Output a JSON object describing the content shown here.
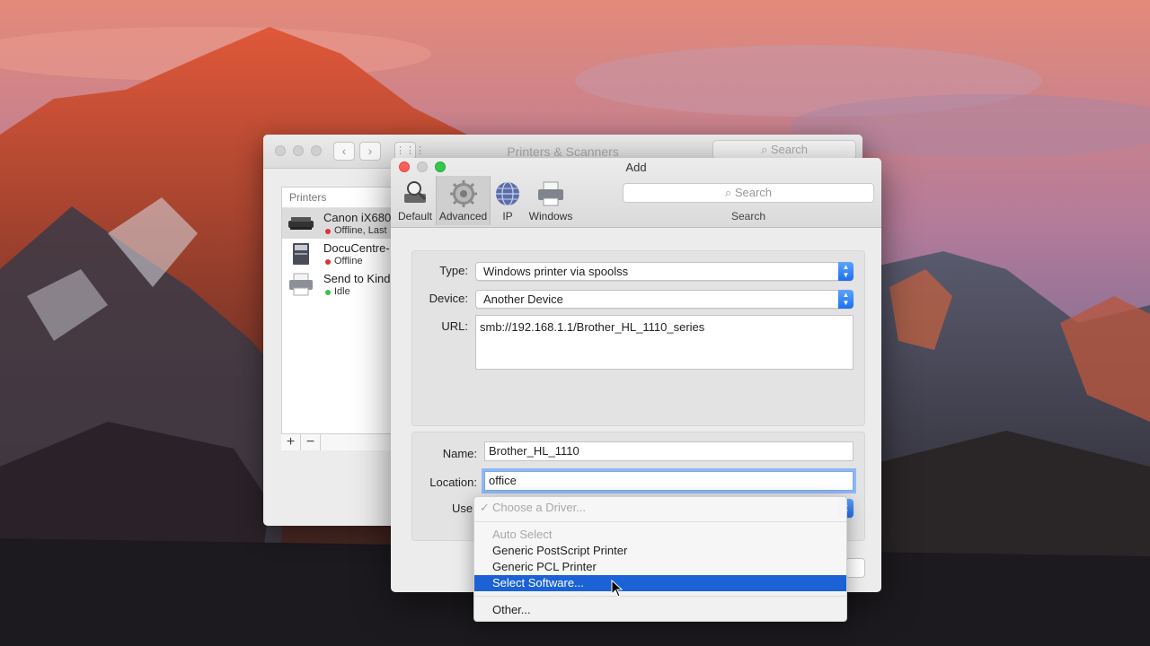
{
  "printers_window": {
    "title": "Printers & Scanners",
    "search_placeholder": "Search",
    "list_header": "Printers",
    "printers": [
      {
        "name": "Canon iX680",
        "status": "Offline, Last",
        "status_color": "#e0303a"
      },
      {
        "name": "DocuCentre-",
        "status": "Offline",
        "status_color": "#e0303a"
      },
      {
        "name": "Send to Kind",
        "status": "Idle",
        "status_color": "#3cc24a"
      }
    ],
    "add_label": "+",
    "remove_label": "−"
  },
  "add_window": {
    "title": "Add",
    "toolbar": {
      "default_label": "Default",
      "advanced_label": "Advanced",
      "ip_label": "IP",
      "windows_label": "Windows",
      "search_placeholder": "Search",
      "search_label": "Search"
    },
    "type_label": "Type:",
    "type_value": "Windows printer via spoolss",
    "device_label": "Device:",
    "device_value": "Another Device",
    "url_label": "URL:",
    "url_value": "smb://192.168.1.1/Brother_HL_1110_series",
    "name_label": "Name:",
    "name_value": "Brother_HL_1110",
    "location_label": "Location:",
    "location_value": "office",
    "use_label": "Use"
  },
  "driver_menu": {
    "check_mark": "✓",
    "choose": "Choose a Driver...",
    "auto_select": "Auto Select",
    "generic_ps": "Generic PostScript Printer",
    "generic_pcl": "Generic PCL Printer",
    "select_software": "Select Software...",
    "other": "Other...",
    "highlight_color": "#1b62d6"
  }
}
